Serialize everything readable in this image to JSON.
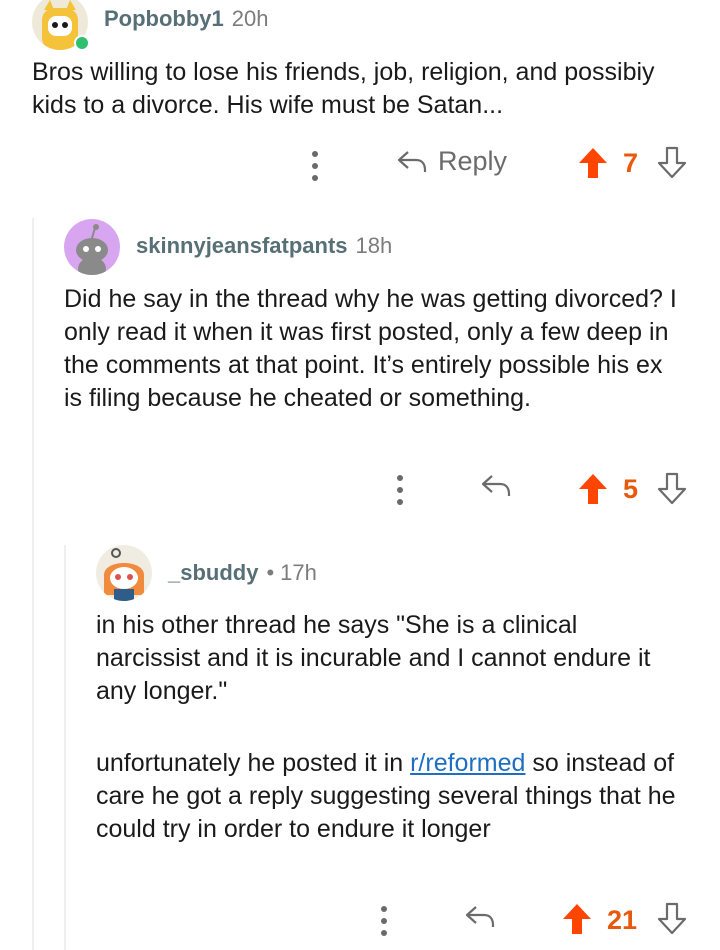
{
  "comments": [
    {
      "username": "Popbobby1",
      "time": "20h",
      "body": "Bros willing to lose his friends, job, religion, and possibiy kids to a divorce. His wife must be Satan...",
      "reply_label": "Reply",
      "score": "7",
      "avatar_color": "#f4c33a",
      "online": true
    },
    {
      "username": "skinnyjeansfatpants",
      "time": "18h",
      "body": "Did he say in the thread why he was getting divorced? I only read it when it was first posted, only a few deep in the comments at that point. It’s entirely possible his ex is filing because he cheated or something.",
      "score": "5",
      "avatar_color": "#d8a6f0"
    },
    {
      "username": "_sbuddy",
      "separator": "•",
      "time": "17h",
      "body_p1": "in his other thread he says \"She is a clinical narcissist and it is incurable and I cannot endure it any longer.\"",
      "body_p2_before": "unfortunately he posted it in ",
      "body_p2_link": "r/reformed",
      "body_p2_after": " so instead of care he got a reply suggesting several things that he could try in order to endure it longer",
      "score": "21",
      "avatar_color": "#f08a3c"
    }
  ],
  "colors": {
    "upvote": "#ff4500",
    "score": "#e8590c",
    "link": "#1e6fc4"
  },
  "icons": [
    "more-options-icon",
    "reply-arrow-icon",
    "upvote-arrow-icon",
    "downvote-arrow-icon"
  ]
}
